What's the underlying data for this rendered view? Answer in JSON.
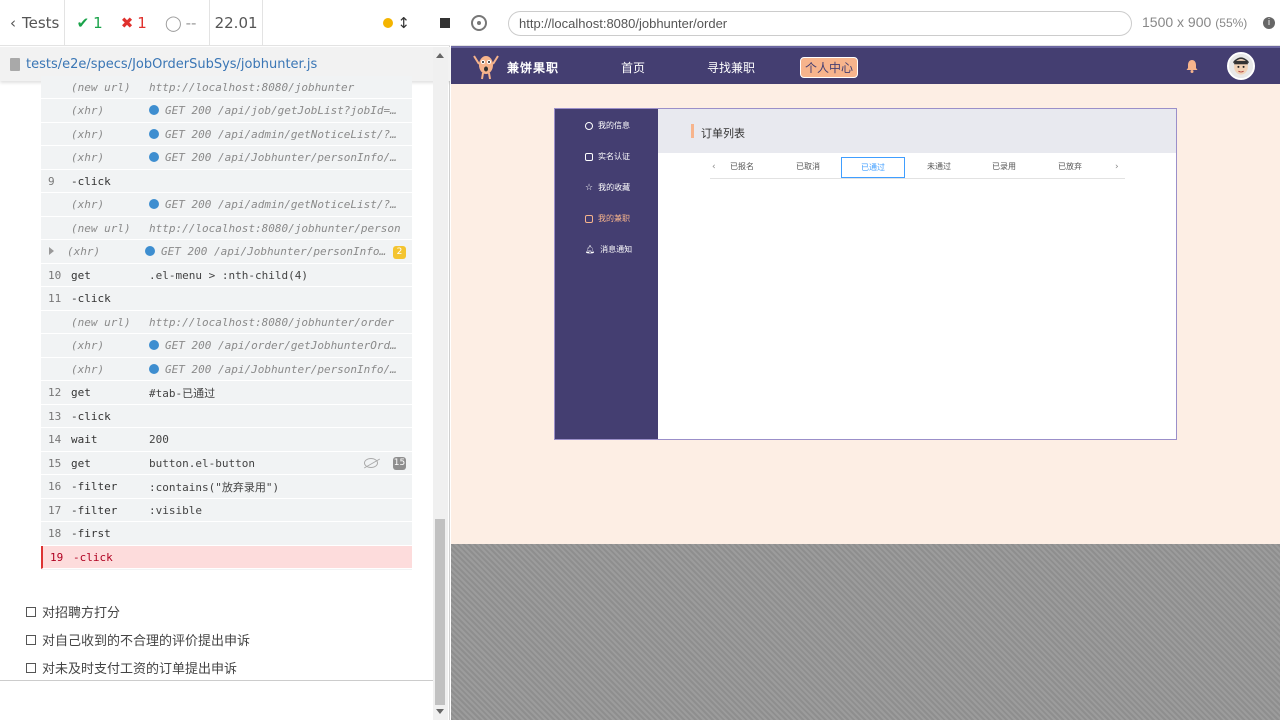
{
  "reporter": {
    "tests_label": "Tests",
    "passed": "1",
    "failed": "1",
    "pending": "--",
    "duration": "22.01",
    "spec_path": "tests/e2e/specs/JobOrderSubSys/jobhunter.js",
    "commands": [
      {
        "num": "",
        "name": "(new url)",
        "msg": "http://localhost:8080/jobhunter",
        "kind": "sub"
      },
      {
        "num": "",
        "name": "(xhr)",
        "msg": "GET 200 /api/job/getJobList?jobId=…",
        "kind": "xhr"
      },
      {
        "num": "",
        "name": "(xhr)",
        "msg": "GET 200 /api/admin/getNoticeList/?…",
        "kind": "xhr"
      },
      {
        "num": "",
        "name": "(xhr)",
        "msg": "GET 200 /api/Jobhunter/personInfo/…",
        "kind": "xhr"
      },
      {
        "num": "9",
        "name": "-click",
        "msg": "",
        "kind": "cmd"
      },
      {
        "num": "",
        "name": "(xhr)",
        "msg": "GET 200 /api/admin/getNoticeList/?…",
        "kind": "xhr"
      },
      {
        "num": "",
        "name": "(new url)",
        "msg": "http://localhost:8080/jobhunter/person",
        "kind": "sub"
      },
      {
        "num": "",
        "name": "(xhr)",
        "msg": "GET 200 /api/Jobhunter/personInfo…",
        "kind": "xhr-group",
        "badge": "2"
      },
      {
        "num": "10",
        "name": "get",
        "msg": ".el-menu > :nth-child(4)",
        "kind": "cmd"
      },
      {
        "num": "11",
        "name": "-click",
        "msg": "",
        "kind": "cmd"
      },
      {
        "num": "",
        "name": "(new url)",
        "msg": "http://localhost:8080/jobhunter/order",
        "kind": "sub"
      },
      {
        "num": "",
        "name": "(xhr)",
        "msg": "GET 200 /api/order/getJobhunterOrd…",
        "kind": "xhr"
      },
      {
        "num": "",
        "name": "(xhr)",
        "msg": "GET 200 /api/Jobhunter/personInfo/…",
        "kind": "xhr"
      },
      {
        "num": "12",
        "name": "get",
        "msg": "#tab-已通过",
        "kind": "cmd"
      },
      {
        "num": "13",
        "name": "-click",
        "msg": "",
        "kind": "cmd"
      },
      {
        "num": "14",
        "name": "wait",
        "msg": "200",
        "kind": "cmd"
      },
      {
        "num": "15",
        "name": "get",
        "msg": "button.el-button",
        "kind": "cmd-hidden",
        "badge": "15"
      },
      {
        "num": "16",
        "name": "-filter",
        "msg": ":contains(\"放弃录用\")",
        "kind": "cmd"
      },
      {
        "num": "17",
        "name": "-filter",
        "msg": ":visible",
        "kind": "cmd"
      },
      {
        "num": "18",
        "name": "-first",
        "msg": "",
        "kind": "cmd"
      },
      {
        "num": "19",
        "name": "-click",
        "msg": "",
        "kind": "fail"
      }
    ],
    "tests": [
      "对招聘方打分",
      "对自己收到的不合理的评价提出申诉",
      "对未及时支付工资的订单提出申诉"
    ]
  },
  "aut_header": {
    "url": "http://localhost:8080/jobhunter/order",
    "viewport": "1500 x 900",
    "scale": "(55%)"
  },
  "app": {
    "brand": "兼饼果职",
    "nav": [
      "首页",
      "寻找兼职",
      "个人中心"
    ],
    "menu": [
      "我的信息",
      "实名认证",
      "我的收藏",
      "我的兼职",
      "消息通知"
    ],
    "page_title": "订单列表",
    "tabs": [
      "已报名",
      "已取消",
      "已通过",
      "未通过",
      "已录用",
      "已放弃"
    ],
    "colors": {
      "nav_bg": "#443e71",
      "accent": "#f7b48c",
      "tab_active": "#409eff"
    }
  }
}
